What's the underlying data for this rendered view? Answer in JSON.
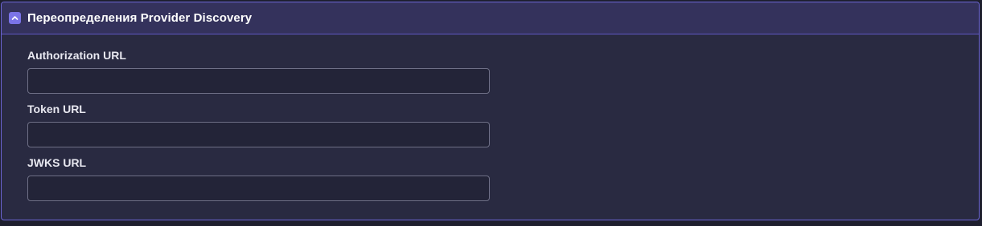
{
  "section": {
    "title": "Переопределения Provider Discovery",
    "toggle_icon": "chevron-up-icon",
    "accent_color": "#7b74e8",
    "border_color": "#6d66d6"
  },
  "fields": [
    {
      "label": "Authorization URL",
      "value": "",
      "placeholder": ""
    },
    {
      "label": "Token URL",
      "value": "",
      "placeholder": ""
    },
    {
      "label": "JWKS URL",
      "value": "",
      "placeholder": ""
    }
  ]
}
